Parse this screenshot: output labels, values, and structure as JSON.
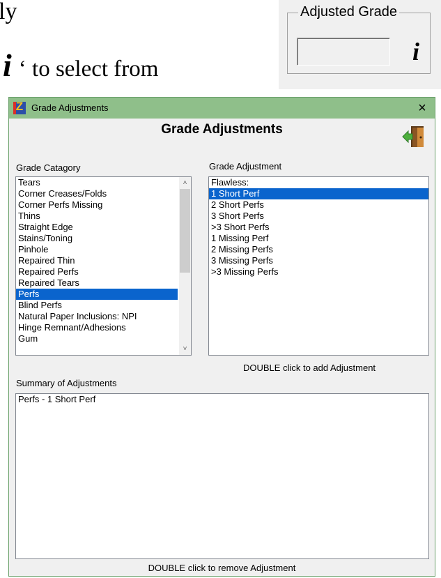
{
  "doc": {
    "line1": "ly",
    "info_glyph": "i",
    "line2_rest": "‘ to select from"
  },
  "adjusted_grade": {
    "legend": "Adjusted Grade",
    "value": "",
    "info_glyph": "i"
  },
  "window": {
    "title": "Grade Adjustments",
    "close_glyph": "×",
    "heading": "Grade Adjustments"
  },
  "category": {
    "label": "Grade Catagory",
    "items": [
      "Tears",
      "Corner Creases/Folds",
      "Corner Perfs Missing",
      "Thins",
      "Straight Edge",
      "Stains/Toning",
      "Pinhole",
      "Repaired Thin",
      "Repaired Perfs",
      "Repaired Tears",
      "Perfs",
      "Blind Perfs",
      "Natural Paper Inclusions: NPI",
      "Hinge Remnant/Adhesions",
      "Gum"
    ],
    "selected": "Perfs",
    "scroll_up": "˄",
    "scroll_down": "˅"
  },
  "adjustment": {
    "label": "Grade Adjustment",
    "items": [
      "Flawless:",
      "1 Short Perf",
      "2 Short Perfs",
      "3 Short Perfs",
      ">3 Short Perfs",
      "1 Missing Perf",
      "2 Missing Perfs",
      "3 Missing Perfs",
      ">3 Missing Perfs"
    ],
    "selected": "1 Short Perf",
    "hint": "DOUBLE click to add Adjustment"
  },
  "summary": {
    "label": "Summary of Adjustments",
    "items": [
      "Perfs - 1 Short Perf"
    ],
    "hint": "DOUBLE click to remove Adjustment"
  },
  "colors": {
    "titlebar": "#8fbf8a",
    "selection": "#0a64cd"
  }
}
